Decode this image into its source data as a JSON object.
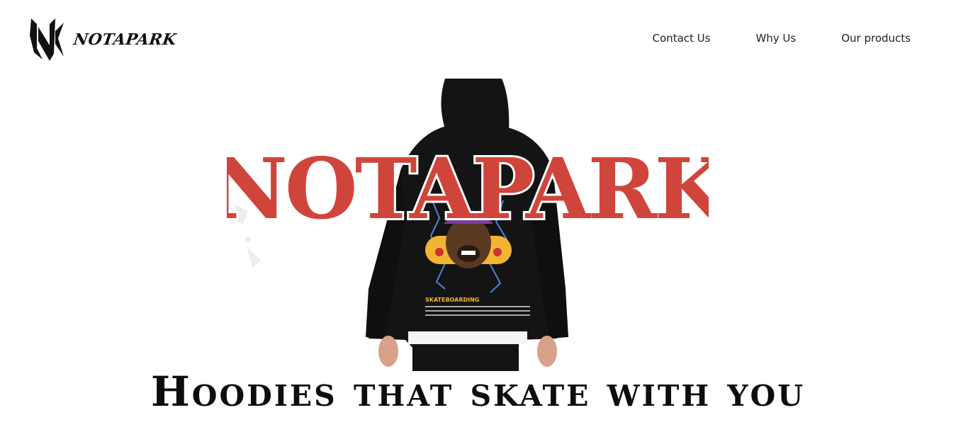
{
  "brand": {
    "name": "NOTAPARK",
    "logo_icon": "nk-monogram-icon"
  },
  "nav": {
    "items": [
      {
        "label": "Contact Us"
      },
      {
        "label": "Why Us"
      },
      {
        "label": "Our products"
      }
    ]
  },
  "hero": {
    "image": "hoodie-back-print-image",
    "wordmark": "NOTAPARK",
    "print_headline": "SKATEBOARDING",
    "colors": {
      "wordmark": "#d0453b",
      "hoodie": "#141414",
      "accent_purple": "#7b3fa0",
      "accent_yellow": "#f2b531"
    }
  },
  "tagline": "Hoodies that skate with you"
}
